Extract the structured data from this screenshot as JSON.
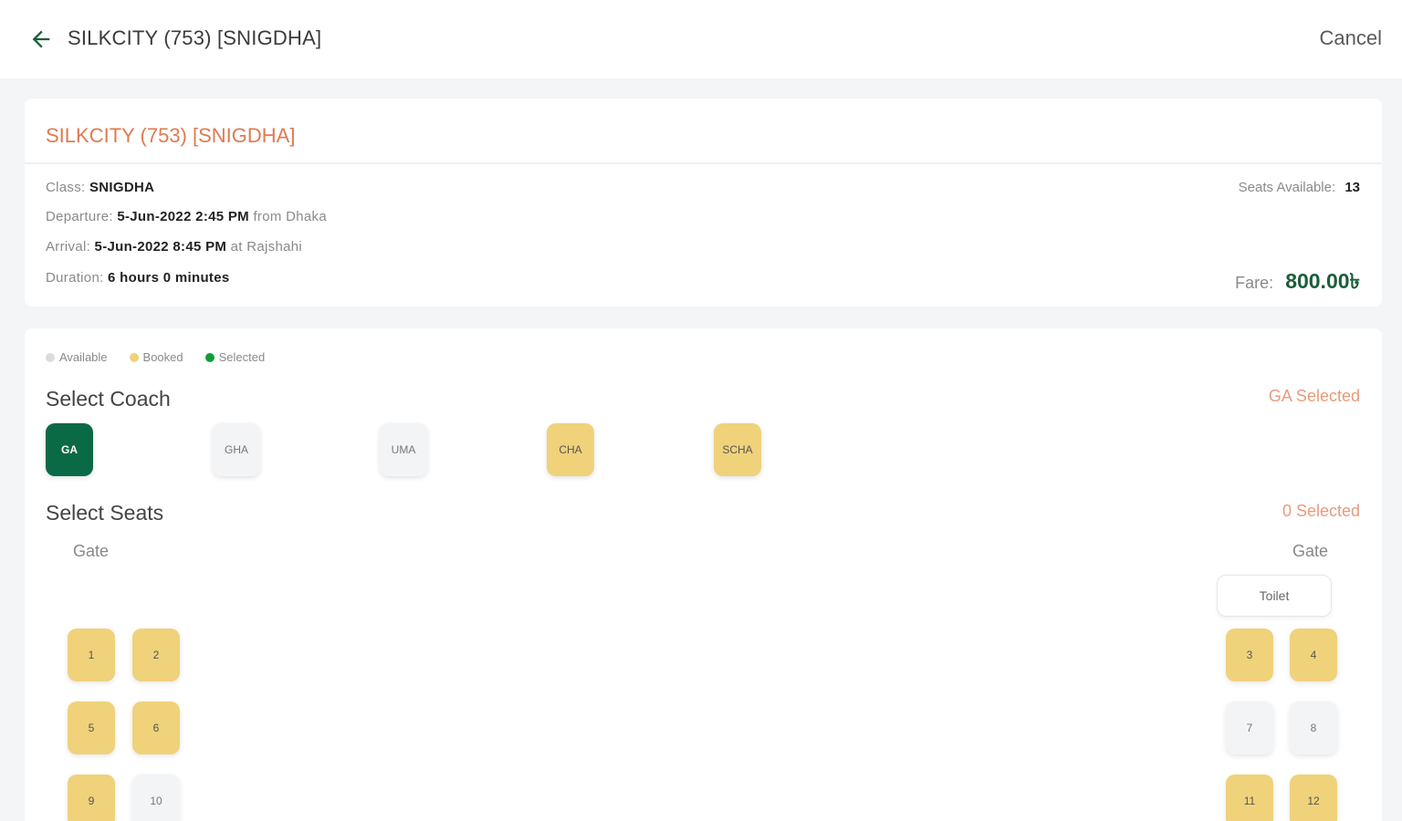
{
  "header": {
    "title": "SILKCITY (753) [SNIGDHA]",
    "cancel_label": "Cancel"
  },
  "trip": {
    "name": "SILKCITY (753) [SNIGDHA]",
    "class_label": "Class:",
    "class_value": "SNIGDHA",
    "departure_label": "Departure:",
    "departure_value": "5-Jun-2022 2:45 PM",
    "departure_suffix": "from Dhaka",
    "arrival_label": "Arrival:",
    "arrival_value": "5-Jun-2022 8:45 PM",
    "arrival_suffix": "at Rajshahi",
    "duration_label": "Duration:",
    "duration_value": "6 hours 0 minutes",
    "seats_available_label": "Seats Available:",
    "seats_available_value": "13",
    "fare_label": "Fare:",
    "fare_value": "800.00৳"
  },
  "legend": {
    "available": "Available",
    "booked": "Booked",
    "selected": "Selected"
  },
  "colors": {
    "available": "#dcdcdc",
    "booked": "#efd27a",
    "selected": "#0f9d3a",
    "accent_green": "#0b6a46",
    "accent_orange": "#e07a4e"
  },
  "coach_section": {
    "title": "Select Coach",
    "selected_text": "GA Selected",
    "coaches": [
      {
        "label": "GA",
        "status": "selected"
      },
      {
        "label": "GHA",
        "status": "available"
      },
      {
        "label": "UMA",
        "status": "available"
      },
      {
        "label": "CHA",
        "status": "booked"
      },
      {
        "label": "SCHA",
        "status": "booked"
      }
    ]
  },
  "seat_section": {
    "title": "Select Seats",
    "selected_text": "0 Selected",
    "gate_left": "Gate",
    "gate_right": "Gate",
    "toilet": "Toilet",
    "seats": [
      {
        "label": "1",
        "status": "booked"
      },
      {
        "label": "2",
        "status": "booked"
      },
      {
        "label": "3",
        "status": "booked"
      },
      {
        "label": "4",
        "status": "booked"
      },
      {
        "label": "5",
        "status": "booked"
      },
      {
        "label": "6",
        "status": "booked"
      },
      {
        "label": "7",
        "status": "available"
      },
      {
        "label": "8",
        "status": "available"
      },
      {
        "label": "9",
        "status": "booked"
      },
      {
        "label": "10",
        "status": "available"
      },
      {
        "label": "11",
        "status": "booked"
      },
      {
        "label": "12",
        "status": "booked"
      }
    ]
  }
}
